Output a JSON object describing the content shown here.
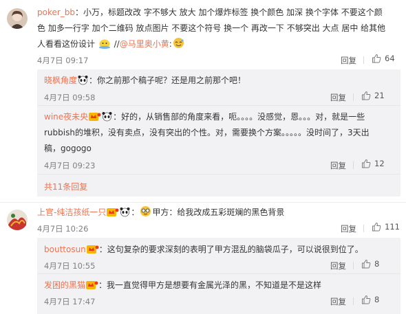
{
  "c1": {
    "user": "poker_bb",
    "text_line1": "：小万，标题改改  字不够大  放大  加个爆炸标签  换个颜色 加深  换个字体  不要这个颜",
    "text_line2": "色 加多一行字   加个二维码   放点图片  不要这个符号  换一个   再改一下  不够突出  大点  居中  给其他",
    "text_line3_pre": "人看看这份设计  ",
    "text_line3_mid": " //",
    "mention": "@马里奥小黄",
    "text_line3_post": ":",
    "time": "4月7日 09:17",
    "reply": "回复",
    "likes": "64"
  },
  "r1": {
    "user": "晓枫角度",
    "text": "：你之前那个稿子呢？还是用之前那个吧！",
    "time": "4月7日 09:58",
    "reply": "回复",
    "likes": "21"
  },
  "r2": {
    "user": "wine夜未央",
    "text_line1": "：好的，从销售部的角度来看，呃。。。。没感觉，恩。。。对，就是一些",
    "text_line2": "rubbish的堆积，没有卖点，没有突出的个性。对，需要换个方案。。。。。没时间了，3天出",
    "text_line3": "稿，gogogo",
    "time": "4月7日 09:23",
    "reply": "回复",
    "likes": "12"
  },
  "more_replies": "共11条回复",
  "c2": {
    "user": "上官-纯洁孩纸一只",
    "text": "甲方：给我改成五彩斑斓的黑色背景",
    "time": "4月7日 10:26",
    "reply": "回复",
    "likes": "111"
  },
  "r3": {
    "user": "bouttosun",
    "text": "：这句复杂的要求深刻的表明了甲方混乱的脑袋瓜子，可以说很到位了。",
    "time": "4月7日 10:55",
    "reply": "回复",
    "likes": "8"
  },
  "r4": {
    "user": "发困的黑猫",
    "text": "：我一直觉得甲方是想要有金属光泽的黑，不知道是不是这样",
    "time": "4月7日 17:47",
    "reply": "回复",
    "likes": "8"
  },
  "colors": {
    "link": "#eb7350",
    "meta": "#808080",
    "sub_bg": "#f2f2f5"
  },
  "icons": {
    "like": "thumbs-up-icon",
    "badge": "member-crown-icon",
    "emoji_panda": "panda-emoji-icon",
    "emoji_bald": "bald-emoji-icon",
    "emoji_sweat": "sweat-smile-emoji-icon",
    "emoji_glasses": "glasses-emoji-icon"
  }
}
